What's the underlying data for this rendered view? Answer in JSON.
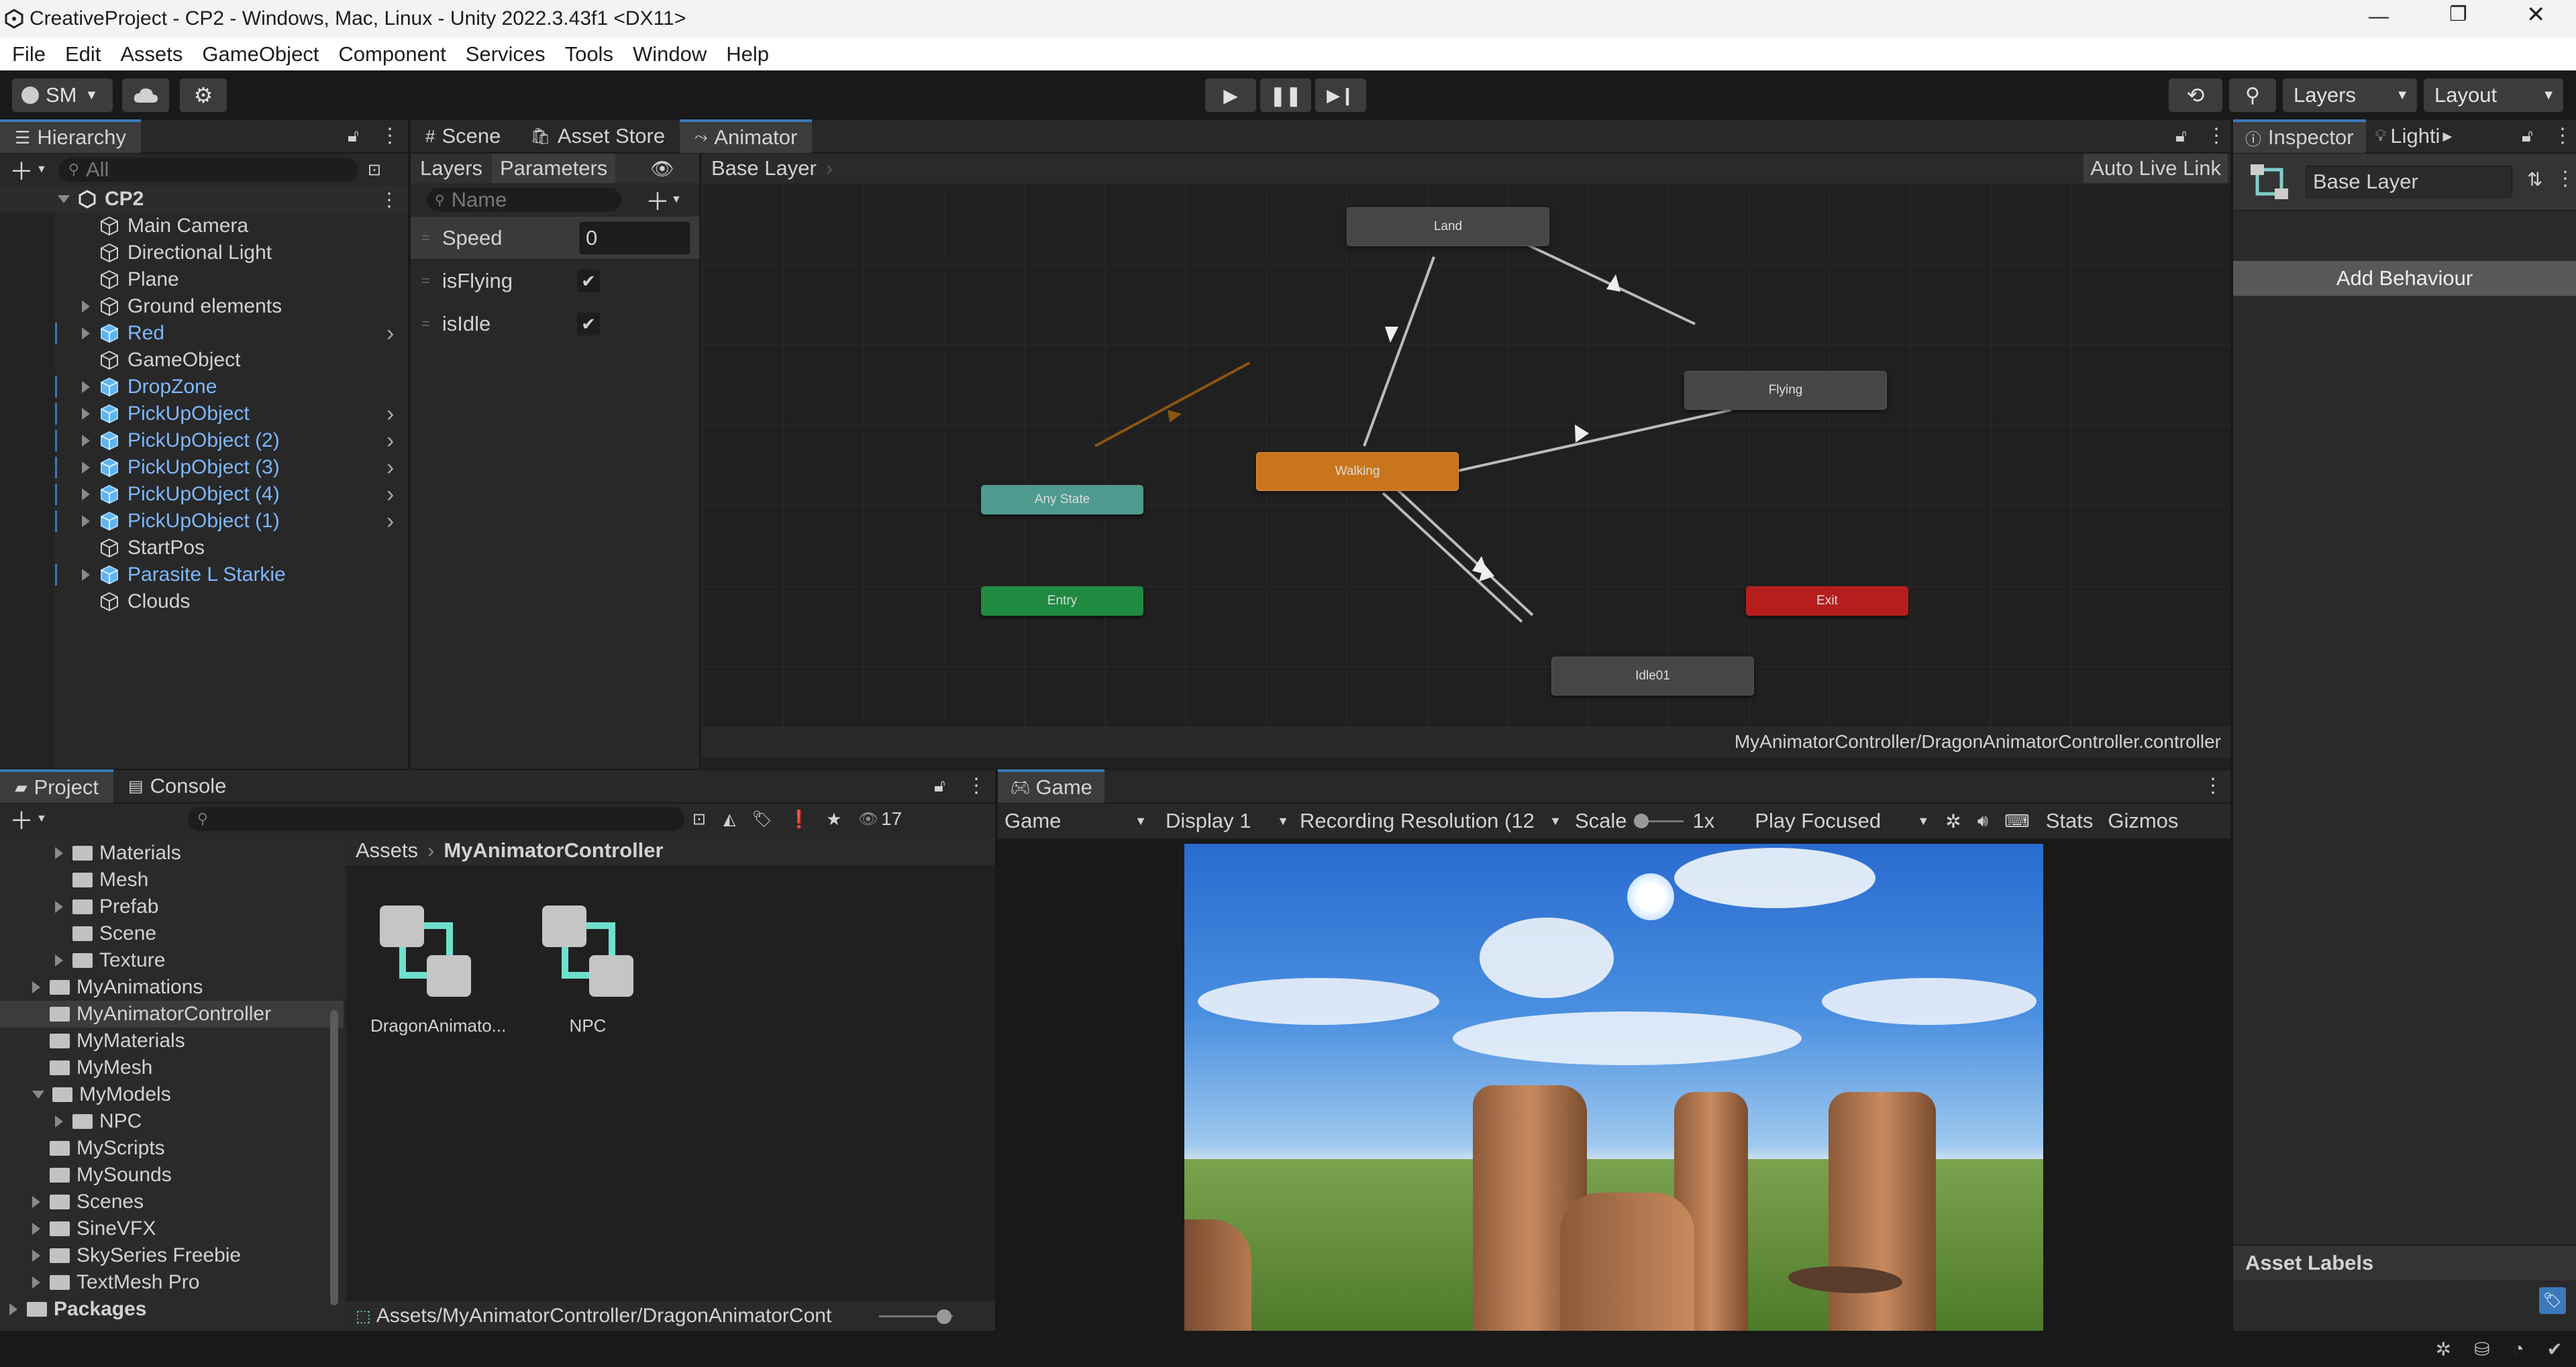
{
  "window": {
    "title": "CreativeProject - CP2 - Windows, Mac, Linux - Unity 2022.3.43f1 <DX11>"
  },
  "menu": [
    "File",
    "Edit",
    "Assets",
    "GameObject",
    "Component",
    "Services",
    "Tools",
    "Window",
    "Help"
  ],
  "toolbar": {
    "account": "SM",
    "layers": "Layers",
    "layout": "Layout"
  },
  "hierarchy": {
    "tab": "Hierarchy",
    "search_placeholder": "All",
    "scene": "CP2",
    "items": [
      {
        "label": "Main Camera"
      },
      {
        "label": "Directional Light"
      },
      {
        "label": "Plane"
      },
      {
        "label": "Ground elements"
      },
      {
        "label": "Red"
      },
      {
        "label": "GameObject"
      },
      {
        "label": "DropZone"
      },
      {
        "label": "PickUpObject"
      },
      {
        "label": "PickUpObject (2)"
      },
      {
        "label": "PickUpObject (3)"
      },
      {
        "label": "PickUpObject (4)"
      },
      {
        "label": "PickUpObject (1)"
      },
      {
        "label": "StartPos"
      },
      {
        "label": "Parasite L Starkie"
      },
      {
        "label": "Clouds"
      }
    ]
  },
  "center_tabs": {
    "scene": "Scene",
    "asset_store": "Asset Store",
    "animator": "Animator"
  },
  "animator": {
    "layers_tab": "Layers",
    "parameters_tab": "Parameters",
    "breadcrumb": "Base Layer",
    "auto_live_link": "Auto Live Link",
    "name_placeholder": "Name",
    "parameters": [
      {
        "name": "Speed",
        "value": "0"
      },
      {
        "name": "isFlying",
        "checked": true
      },
      {
        "name": "isIdle",
        "checked": true
      }
    ],
    "states": {
      "land": "Land",
      "flying": "Flying",
      "walking": "Walking",
      "any_state": "Any State",
      "entry": "Entry",
      "exit": "Exit",
      "idle": "Idle01"
    },
    "footer_path": "MyAnimatorController/DragonAnimatorController.controller",
    "colors": {
      "default_state": "#8c5512",
      "entry": "#1c7a3a",
      "exit": "#a31c1c",
      "any_state": "#3e8a80",
      "state": "#464646"
    }
  },
  "inspector": {
    "tab": "Inspector",
    "lighting_tab": "Lighti",
    "name_value": "Base Layer",
    "add_behaviour": "Add Behaviour",
    "asset_labels": "Asset Labels"
  },
  "project": {
    "tab": "Project",
    "console_tab": "Console",
    "hidden_count": "17",
    "tree": [
      {
        "label": "Materials",
        "indent": 1,
        "arrow": "right"
      },
      {
        "label": "Mesh",
        "indent": 1,
        "arrow": "none"
      },
      {
        "label": "Prefab",
        "indent": 1,
        "arrow": "right"
      },
      {
        "label": "Scene",
        "indent": 1,
        "arrow": "none"
      },
      {
        "label": "Texture",
        "indent": 1,
        "arrow": "right"
      },
      {
        "label": "MyAnimations",
        "indent": 0,
        "arrow": "right"
      },
      {
        "label": "MyAnimatorController",
        "indent": 0,
        "arrow": "none",
        "selected": true
      },
      {
        "label": "MyMaterials",
        "indent": 0,
        "arrow": "none"
      },
      {
        "label": "MyMesh",
        "indent": 0,
        "arrow": "none"
      },
      {
        "label": "MyModels",
        "indent": 0,
        "arrow": "down"
      },
      {
        "label": "NPC",
        "indent": 1,
        "arrow": "right"
      },
      {
        "label": "MyScripts",
        "indent": 0,
        "arrow": "none"
      },
      {
        "label": "MySounds",
        "indent": 0,
        "arrow": "none"
      },
      {
        "label": "Scenes",
        "indent": 0,
        "arrow": "right"
      },
      {
        "label": "SineVFX",
        "indent": 0,
        "arrow": "right"
      },
      {
        "label": "SkySeries Freebie",
        "indent": 0,
        "arrow": "right"
      },
      {
        "label": "TextMesh Pro",
        "indent": 0,
        "arrow": "right"
      }
    ],
    "packages": "Packages",
    "breadcrumb_root": "Assets",
    "breadcrumb_current": "MyAnimatorController",
    "assets": [
      {
        "label": "DragonAnimato..."
      },
      {
        "label": "NPC"
      }
    ],
    "footer_path": "Assets/MyAnimatorController/DragonAnimatorCont"
  },
  "game": {
    "tab": "Game",
    "view_select": "Game",
    "display": "Display 1",
    "resolution": "Recording Resolution (12",
    "scale_label": "Scale",
    "scale_value": "1x",
    "play_mode": "Play Focused",
    "stats": "Stats",
    "gizmos": "Gizmos"
  }
}
